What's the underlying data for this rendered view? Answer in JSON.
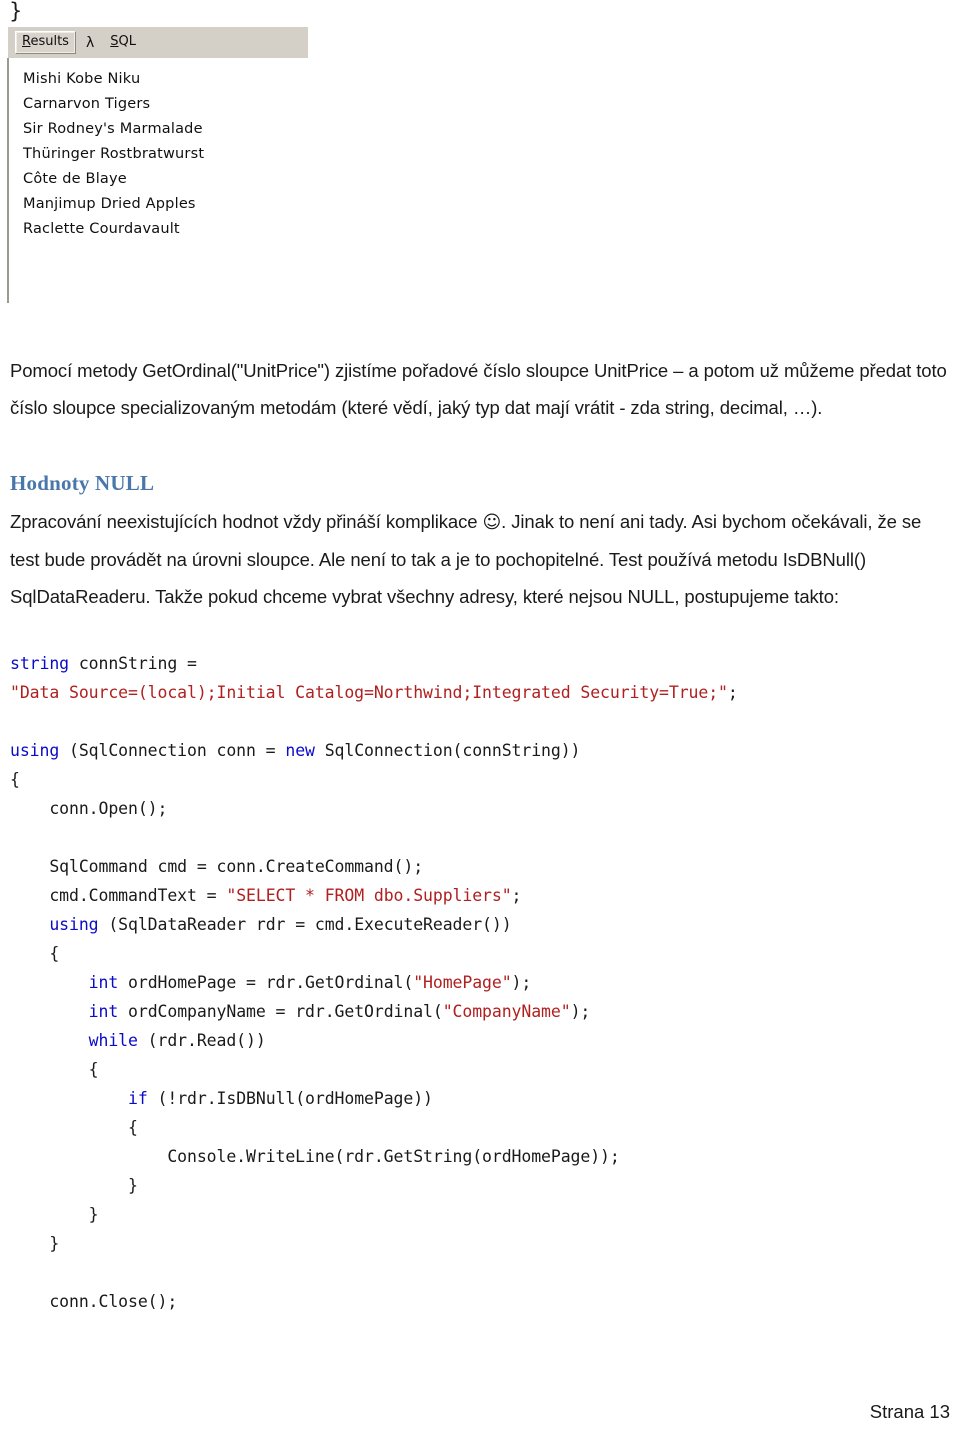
{
  "screenshot": {
    "brace": "}",
    "tabs": [
      {
        "name": "results",
        "accel": "R",
        "rest": "esults",
        "selected": true
      },
      {
        "name": "lambda",
        "glyph": "λ",
        "selected": false
      },
      {
        "name": "sql",
        "accel": "S",
        "rest": "QL",
        "selected": false
      }
    ],
    "results_rows": [
      "Mishi Kobe Niku",
      "Carnarvon Tigers",
      "Sir Rodney's Marmalade",
      "Thüringer Rostbratwurst",
      "Côte de Blaye",
      "Manjimup Dried Apples",
      "Raclette Courdavault"
    ]
  },
  "content": {
    "para_ordinal": "Pomocí metody GetOrdinal(\"UnitPrice\") zjistíme pořadové číslo sloupce UnitPrice – a potom už můžeme předat toto číslo sloupce specializovaným metodám (které vědí, jaký typ dat mají vrátit - zda string, decimal, …).",
    "heading_null": "Hodnoty NULL",
    "para_null_before_smiley": "Zpracování neexistujících hodnot vždy přináší komplikace ",
    "smiley": "☺",
    "para_null_after_smiley": ". Jinak to není ani tady. Asi bychom očekávali, že se test bude provádět na úrovni sloupce. Ale není to tak a je to pochopitelné. Test používá metodu IsDBNull() SqlDataReaderu. Takže pokud chceme vybrat všechny adresy, které nejsou NULL, postupujeme takto:"
  },
  "code": {
    "lines": [
      [
        {
          "t": "kw",
          "v": "string"
        },
        {
          "t": "p",
          "v": " connString ="
        }
      ],
      [
        {
          "t": "str",
          "v": "\"Data Source=(local);Initial Catalog=Northwind;Integrated Security=True;\""
        },
        {
          "t": "p",
          "v": ";"
        }
      ],
      [],
      [
        {
          "t": "kw",
          "v": "using"
        },
        {
          "t": "p",
          "v": " (SqlConnection conn = "
        },
        {
          "t": "kw",
          "v": "new"
        },
        {
          "t": "p",
          "v": " SqlConnection(connString))"
        }
      ],
      [
        {
          "t": "p",
          "v": "{"
        }
      ],
      [
        {
          "t": "p",
          "v": "    conn.Open();"
        }
      ],
      [],
      [
        {
          "t": "p",
          "v": "    SqlCommand cmd = conn.CreateCommand();"
        }
      ],
      [
        {
          "t": "p",
          "v": "    cmd.CommandText = "
        },
        {
          "t": "str",
          "v": "\"SELECT * FROM dbo.Suppliers\""
        },
        {
          "t": "p",
          "v": ";"
        }
      ],
      [
        {
          "t": "p",
          "v": "    "
        },
        {
          "t": "kw",
          "v": "using"
        },
        {
          "t": "p",
          "v": " (SqlDataReader rdr = cmd.ExecuteReader())"
        }
      ],
      [
        {
          "t": "p",
          "v": "    {"
        }
      ],
      [
        {
          "t": "p",
          "v": "        "
        },
        {
          "t": "kw",
          "v": "int"
        },
        {
          "t": "p",
          "v": " ordHomePage = rdr.GetOrdinal("
        },
        {
          "t": "str",
          "v": "\"HomePage\""
        },
        {
          "t": "p",
          "v": ");"
        }
      ],
      [
        {
          "t": "p",
          "v": "        "
        },
        {
          "t": "kw",
          "v": "int"
        },
        {
          "t": "p",
          "v": " ordCompanyName = rdr.GetOrdinal("
        },
        {
          "t": "str",
          "v": "\"CompanyName\""
        },
        {
          "t": "p",
          "v": ");"
        }
      ],
      [
        {
          "t": "p",
          "v": "        "
        },
        {
          "t": "kw",
          "v": "while"
        },
        {
          "t": "p",
          "v": " (rdr.Read())"
        }
      ],
      [
        {
          "t": "p",
          "v": "        {"
        }
      ],
      [
        {
          "t": "p",
          "v": "            "
        },
        {
          "t": "kw",
          "v": "if"
        },
        {
          "t": "p",
          "v": " (!rdr.IsDBNull(ordHomePage))"
        }
      ],
      [
        {
          "t": "p",
          "v": "            {"
        }
      ],
      [
        {
          "t": "p",
          "v": "                Console.WriteLine(rdr.GetString(ordHomePage));"
        }
      ],
      [
        {
          "t": "p",
          "v": "            }"
        }
      ],
      [
        {
          "t": "p",
          "v": "        }"
        }
      ],
      [
        {
          "t": "p",
          "v": "    }"
        }
      ],
      [],
      [
        {
          "t": "p",
          "v": "    conn.Close();"
        }
      ]
    ]
  },
  "footer": {
    "page_label": "Strana 13"
  },
  "colors": {
    "heading": "#4a77aa",
    "keyword": "#0b0bc8",
    "string": "#b02020",
    "tabbar": "#d4d0c8"
  }
}
